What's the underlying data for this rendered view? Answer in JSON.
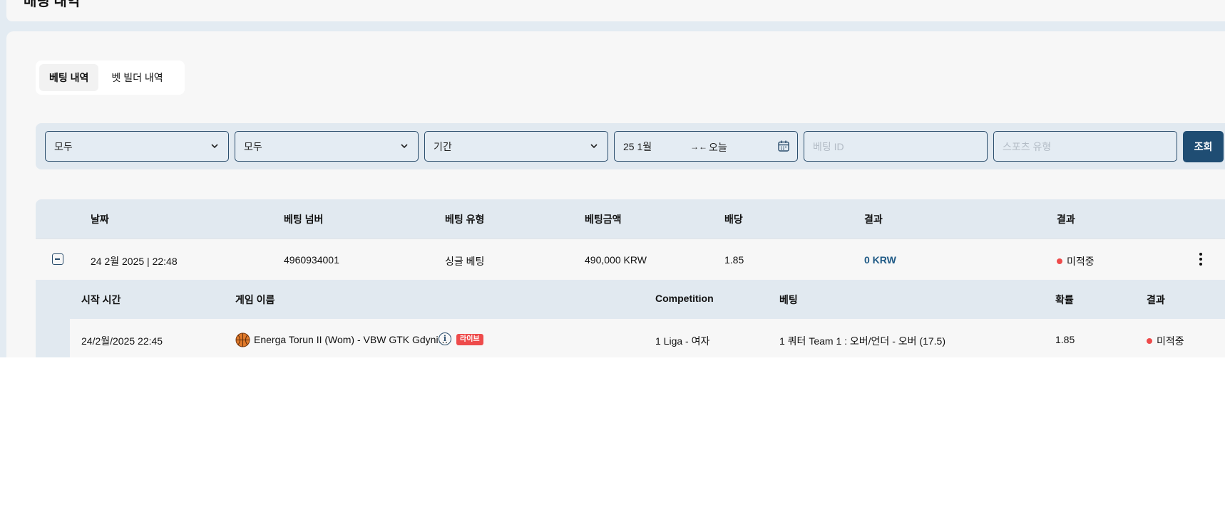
{
  "page": {
    "title": "배팅 내역"
  },
  "tabs": [
    {
      "label": "베팅 내역",
      "active": true
    },
    {
      "label": "벳 빌더 내역",
      "active": false
    }
  ],
  "filters": {
    "select1": "모두",
    "select2": "모두",
    "period": "기간",
    "date_from": "25 1월",
    "date_to": "오늘",
    "bet_id_placeholder": "베팅 ID",
    "sport_type_placeholder": "스포츠 유형",
    "search_label": "조회"
  },
  "table": {
    "headers": [
      "날짜",
      "베팅 넘버",
      "베팅 유형",
      "베팅금액",
      "배당",
      "결과",
      "결과"
    ],
    "rows": [
      {
        "date": "24 2월 2025 | 22:48",
        "bet_number": "4960934001",
        "bet_type": "싱글 베팅",
        "amount": "490,000 KRW",
        "odds": "1.85",
        "win": "0 KRW",
        "status": "미적중"
      }
    ]
  },
  "details": {
    "headers": [
      "시작 시간",
      "게임 이름",
      "Competition",
      "베팅",
      "확률",
      "결과"
    ],
    "rows": [
      {
        "start_time": "24/2월/2025 22:45",
        "game_name": "Energa Torun II (Wom) - VBW GTK Gdyni…",
        "live_label": "라이브",
        "competition": "1 Liga - 여자",
        "bet": "1 쿼터 Team 1 : 오버/언더 - 오버 (17.5)",
        "odds": "1.85",
        "status": "미적중"
      }
    ]
  },
  "colors": {
    "accent": "#1f4d73",
    "live": "#ee4b4b",
    "lost": "#ee4b4b",
    "win_text": "#1f5a86"
  },
  "icons": [
    "chevron-down-icon",
    "swap-arrows-icon",
    "calendar-icon",
    "collapse-icon",
    "kebab-menu-icon",
    "basketball-icon",
    "info-icon"
  ]
}
